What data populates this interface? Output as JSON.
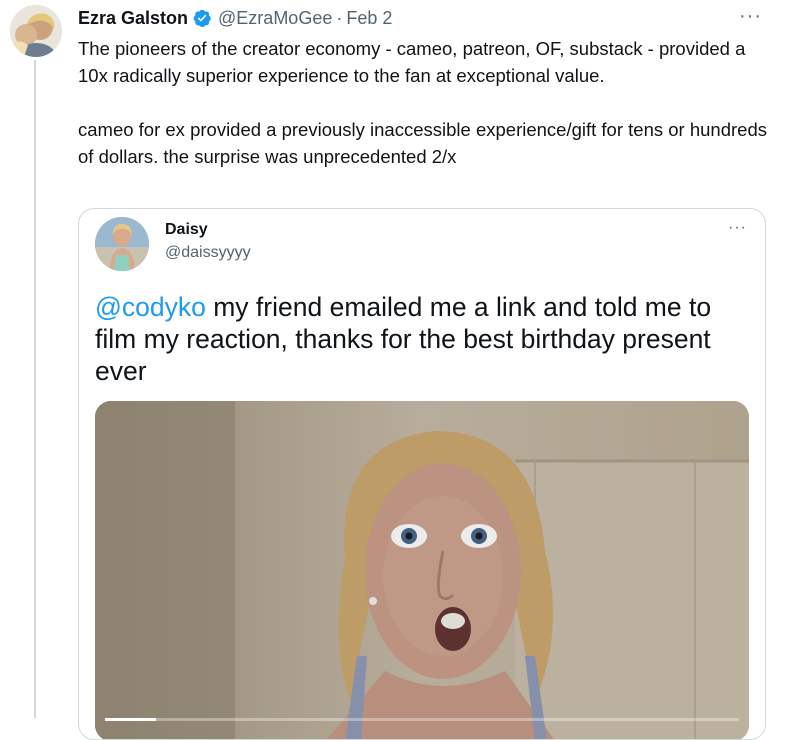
{
  "tweet": {
    "author_name": "Ezra Galston",
    "handle": "@EzraMoGee",
    "separator": "·",
    "date": "Feb 2",
    "more": "···",
    "paragraphs": [
      "The pioneers of the creator economy - cameo, patreon, OF, substack - provided a 10x radically superior experience to the fan at exceptional value.",
      "cameo for ex provided a previously inaccessible experience/gift for tens or hundreds of dollars. the surprise was unprecedented 2/x"
    ]
  },
  "quoted_tweet": {
    "author_name": "Daisy",
    "handle": "@daissyyyy",
    "more": "···",
    "mention": "@codyko",
    "text": " my friend emailed me a link and told me to film my reaction, thanks for the best birthday present ever"
  },
  "video": {
    "progress_fraction": 0.08
  },
  "colors": {
    "link": "#1d9bf0",
    "verified": "#1d9bf0",
    "secondary_text": "#536471",
    "border": "#cfd9de"
  },
  "icons": [
    "verified-badge-icon",
    "more-options-icon"
  ]
}
